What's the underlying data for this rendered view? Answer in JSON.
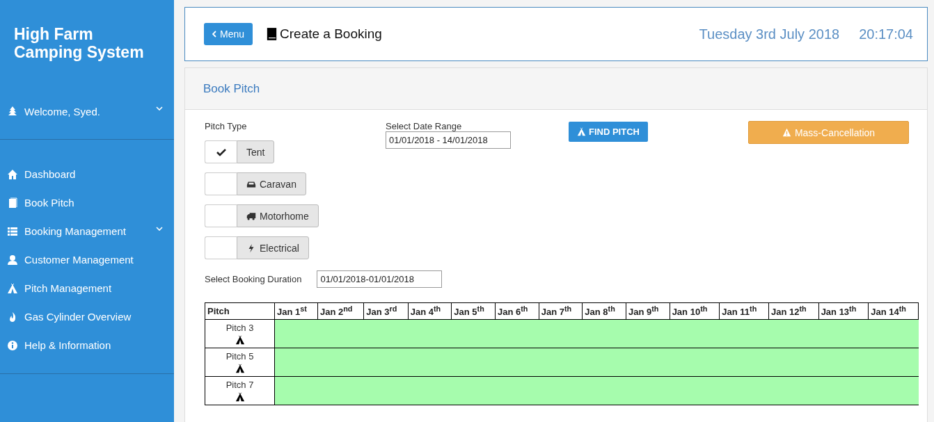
{
  "sidebar": {
    "title": "High Farm Camping System",
    "user": {
      "label": "Welcome, Syed.",
      "expandable": true
    },
    "items": [
      {
        "label": "Dashboard",
        "expandable": false
      },
      {
        "label": "Book Pitch",
        "expandable": false
      },
      {
        "label": "Booking Management",
        "expandable": true
      },
      {
        "label": "Customer Management",
        "expandable": false
      },
      {
        "label": "Pitch Management",
        "expandable": false
      },
      {
        "label": "Gas Cylinder Overview",
        "expandable": false
      },
      {
        "label": "Help & Information",
        "expandable": false
      }
    ]
  },
  "header": {
    "menu_button": "Menu",
    "title": "Create a Booking",
    "date": "Tuesday 3rd July 2018",
    "time": "20:17:04"
  },
  "panel": {
    "title": "Book Pitch",
    "pitch_type": {
      "label": "Pitch Type",
      "options": [
        {
          "label": "Tent",
          "checked": true
        },
        {
          "label": "Caravan",
          "checked": false
        },
        {
          "label": "Motorhome",
          "checked": false
        },
        {
          "label": "Electrical",
          "checked": false
        }
      ]
    },
    "date_range": {
      "label": "Select Date Range",
      "value": "01/01/2018 - 14/01/2018"
    },
    "find_button": "FIND PITCH",
    "cancel_button": "Mass-Cancellation",
    "duration": {
      "label": "Select Booking Duration",
      "value": "01/01/2018-01/01/2018"
    },
    "table": {
      "columns": [
        "Pitch",
        "Jan 1$^{st}$",
        "Jan 2$^{nd}$",
        "Jan 3$^{rd}$",
        "Jan 4$^{th}$",
        "Jan 5$^{th}$",
        "Jan 6$^{th}$",
        "Jan 7$^{th}$",
        "Jan 8$^{th}$",
        "Jan 9$^{th}$",
        "Jan 10$^{th}$",
        "Jan 11$^{th}$",
        "Jan 12$^{th}$",
        "Jan 13$^{th}$",
        "Jan 14$^{th}$"
      ],
      "rows": [
        {
          "pitch": "Pitch 3",
          "color": "#a6fcad"
        },
        {
          "pitch": "Pitch 5",
          "color": "#a6fcad"
        },
        {
          "pitch": "Pitch 7",
          "color": "#a6fcad"
        }
      ]
    }
  }
}
